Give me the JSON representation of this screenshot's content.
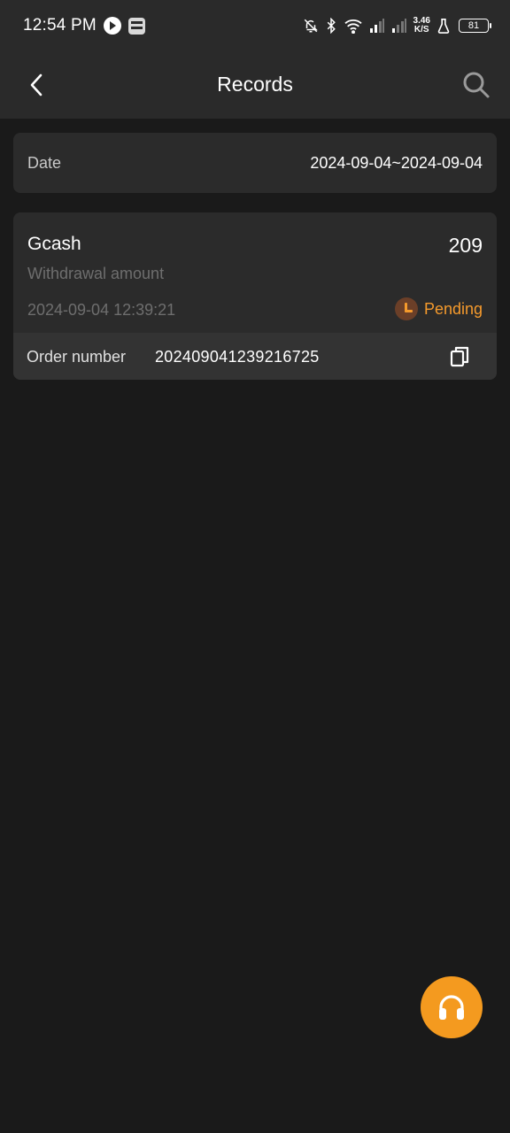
{
  "status_bar": {
    "time": "12:54 PM",
    "net_speed_value": "3.46",
    "net_speed_unit": "K/S",
    "battery": "81",
    "icons": [
      "media-app-icon",
      "gallery-app-icon",
      "muted-bell-icon",
      "bluetooth-icon",
      "wifi-icon",
      "signal-icon",
      "signal-icon",
      "lab-icon",
      "battery-icon"
    ]
  },
  "nav": {
    "title": "Records",
    "back_icon": "chevron-left-icon",
    "search_icon": "search-icon"
  },
  "filter": {
    "date_label": "Date",
    "date_range": "2024-09-04~2024-09-04"
  },
  "records": [
    {
      "method": "Gcash",
      "amount": "209",
      "type": "Withdrawal amount",
      "datetime": "2024-09-04 12:39:21",
      "status": "Pending",
      "order_label": "Order number",
      "order_number": "202409041239216725"
    }
  ],
  "support": {
    "icon": "headset-icon"
  },
  "colors": {
    "background": "#1a1a1a",
    "header": "#2a2a2a",
    "card": "#2b2b2b",
    "accent": "#f59a2c",
    "muted_text": "#6e6e6e"
  }
}
